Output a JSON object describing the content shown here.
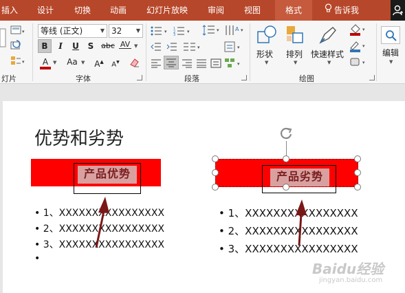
{
  "ribbon_tabs": [
    "插入",
    "设计",
    "切换",
    "动画",
    "幻灯片放映",
    "审阅",
    "视图",
    "格式"
  ],
  "tell_me": "告诉我",
  "groups": {
    "slides_label": "灯片",
    "font_label": "字体",
    "paragraph_label": "段落",
    "drawing_label": "绘图",
    "editing_label": "编辑"
  },
  "font": {
    "name": "等线 (正文)",
    "size": "32",
    "bold": "B",
    "italic": "I",
    "underline": "U",
    "shadow": "S",
    "strike": "abc",
    "spacing": "AV",
    "color_letter": "A",
    "case": "Aa",
    "grow": "A",
    "shrink": "A"
  },
  "drawing": {
    "shapes": "形状",
    "arrange": "排列",
    "quick_styles": "快速样式"
  },
  "colors": {
    "tab_bar": "#b7472a",
    "shape_red": "#ff0000",
    "arrow": "#7b1717"
  },
  "slide": {
    "title": "优势和劣势",
    "left_label": "产品优势",
    "right_label": "产品劣势",
    "left_bullets": [
      "1、XXXXXXXXXXXXXXXX",
      "2、XXXXXXXXXXXXXXXX",
      "3、XXXXXXXXXXXXXXXX",
      ""
    ],
    "right_bullets": [
      "1、XXXXXXXXXXXXXXXX",
      "2、XXXXXXXXXXXXXXXX",
      "3、XXXXXXXXXXXXXXXX"
    ],
    "bullet_char": "•"
  },
  "watermark": {
    "logo": "Baidu经验",
    "url": "jingyan.baidu.com"
  }
}
